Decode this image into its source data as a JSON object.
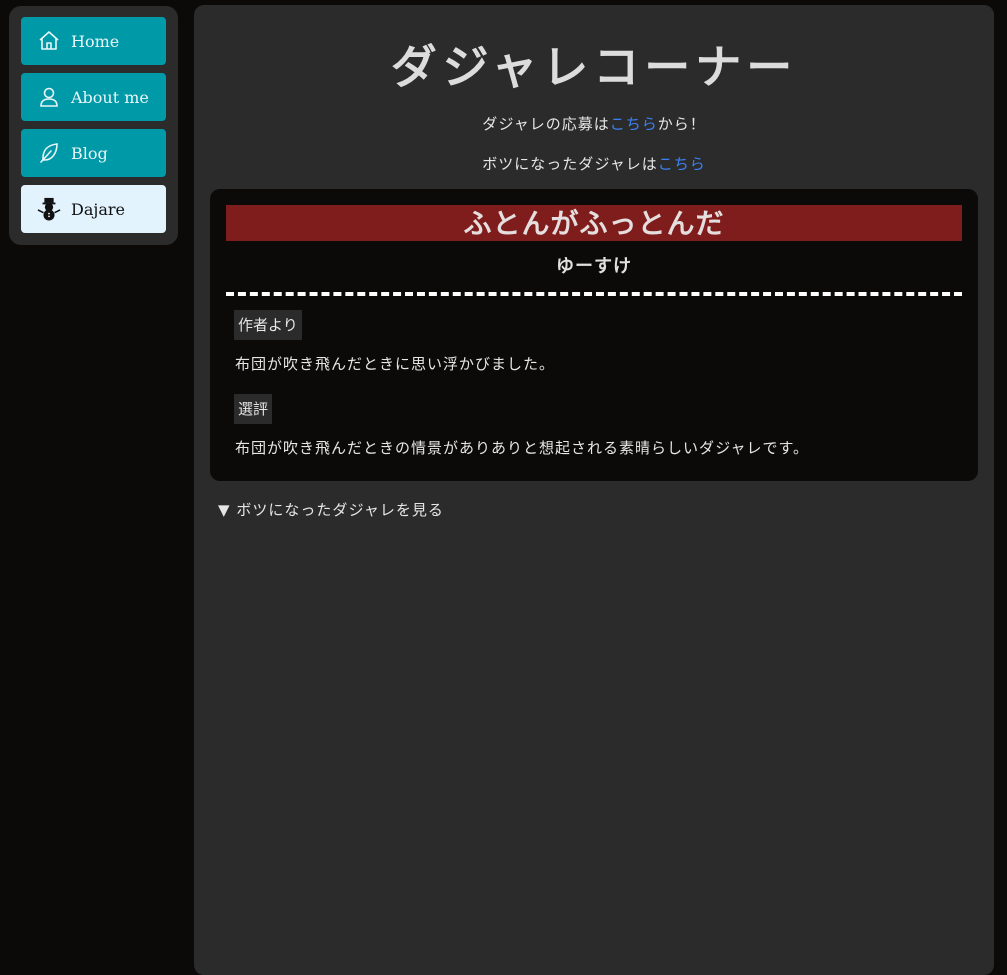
{
  "nav": {
    "items": [
      {
        "label": "Home",
        "icon": "home-icon"
      },
      {
        "label": "About me",
        "icon": "person-icon"
      },
      {
        "label": "Blog",
        "icon": "feather-icon"
      },
      {
        "label": "Dajare",
        "icon": "snowman-icon",
        "active": true
      }
    ]
  },
  "main": {
    "title": "ダジャレコーナー",
    "submit_prefix": "ダジャレの応募は",
    "submit_link": "こちら",
    "submit_suffix": "から！",
    "rejected_prefix": "ボツになったダジャレは",
    "rejected_link": "こちら"
  },
  "card": {
    "title": "ふとんがふっとんだ",
    "author": "ゆーすけ",
    "author_note_label": "作者より",
    "author_note": "布団が吹き飛んだときに思い浮かびました。",
    "review_label": "選評",
    "review": "布団が吹き飛んだときの情景がありありと想起される素晴らしいダジャレです。"
  },
  "details": {
    "summary": "ボツになったダジャレを見る"
  },
  "colors": {
    "nav_button": "#0099a8",
    "nav_active": "#e2f3fd",
    "title_bar": "#7e1d1c",
    "link": "#3b82f6",
    "panel": "#2b2b2b",
    "background": "#0b0a09"
  }
}
